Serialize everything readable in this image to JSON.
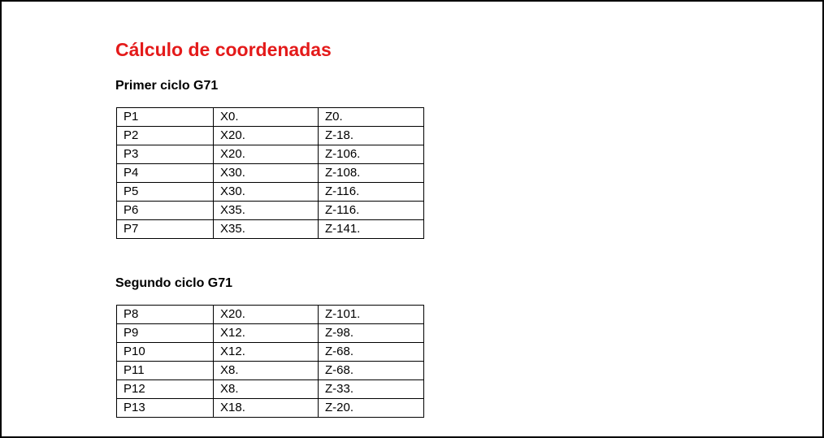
{
  "document": {
    "title": "Cálculo de coordenadas",
    "title_color": "#e41a1a",
    "sections": [
      {
        "heading": "Primer ciclo G71",
        "rows": [
          [
            "P1",
            "X0.",
            "Z0."
          ],
          [
            "P2",
            "X20.",
            "Z-18."
          ],
          [
            "P3",
            "X20.",
            "Z-106."
          ],
          [
            "P4",
            "X30.",
            "Z-108."
          ],
          [
            "P5",
            "X30.",
            "Z-116."
          ],
          [
            "P6",
            "X35.",
            "Z-116."
          ],
          [
            "P7",
            "X35.",
            "Z-141."
          ]
        ]
      },
      {
        "heading": "Segundo ciclo G71",
        "rows": [
          [
            "P8",
            "X20.",
            "Z-101."
          ],
          [
            "P9",
            "X12.",
            "Z-98."
          ],
          [
            "P10",
            "X12.",
            "Z-68."
          ],
          [
            "P11",
            "X8.",
            "Z-68."
          ],
          [
            "P12",
            "X8.",
            "Z-33."
          ],
          [
            "P13",
            "X18.",
            "Z-20."
          ]
        ]
      }
    ]
  }
}
